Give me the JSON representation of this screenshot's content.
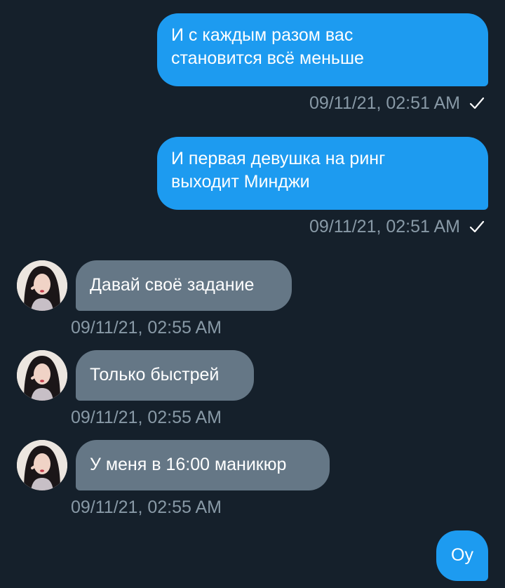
{
  "messages": [
    {
      "text": "И с каждым разом вас\nстановится всё меньше",
      "time": "09/11/21, 02:51 AM"
    },
    {
      "text": "И первая девушка на ринг\nвыходит Минджи",
      "time": "09/11/21, 02:51 AM"
    },
    {
      "text": "Давай своё задание",
      "time": "09/11/21, 02:55 AM"
    },
    {
      "text": "Только быстрей",
      "time": "09/11/21, 02:55 AM"
    },
    {
      "text": "У меня в 16:00 маникюр",
      "time": "09/11/21, 02:55 AM"
    },
    {
      "text": "Оу"
    }
  ],
  "colors": {
    "background": "#15202b",
    "outgoing_bubble": "#1d9bf0",
    "incoming_bubble": "#657786",
    "timestamp": "#8899a6"
  },
  "icons": {
    "read_receipt": "check-icon",
    "sender": "avatar"
  }
}
